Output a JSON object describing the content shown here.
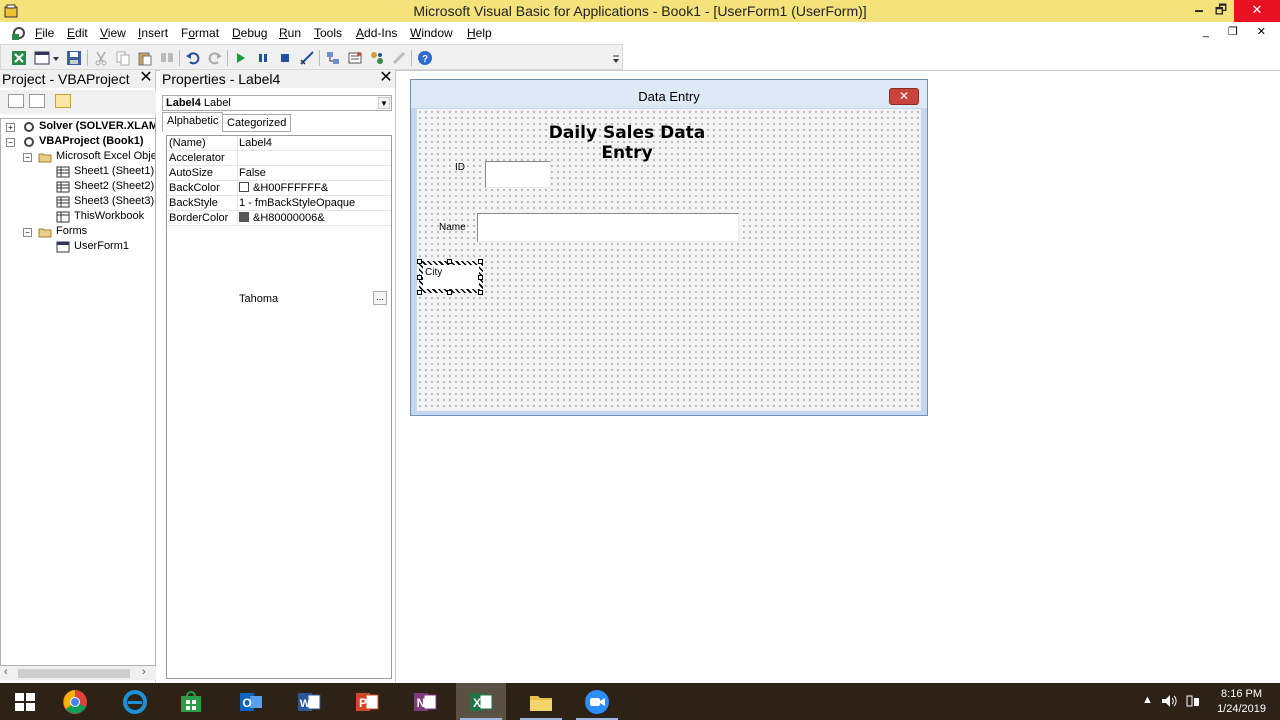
{
  "window": {
    "title": "Microsoft Visual Basic for Applications - Book1 - [UserForm1 (UserForm)]",
    "minimize": "🗕",
    "restore": "🗗",
    "close": "✕"
  },
  "menubar": {
    "items": [
      {
        "pre": "",
        "u": "F",
        "post": "ile"
      },
      {
        "pre": "",
        "u": "E",
        "post": "dit"
      },
      {
        "pre": "",
        "u": "V",
        "post": "iew"
      },
      {
        "pre": "",
        "u": "I",
        "post": "nsert"
      },
      {
        "pre": "F",
        "u": "o",
        "post": "rmat"
      },
      {
        "pre": "",
        "u": "D",
        "post": "ebug"
      },
      {
        "pre": "",
        "u": "R",
        "post": "un"
      },
      {
        "pre": "",
        "u": "T",
        "post": "ools"
      },
      {
        "pre": "",
        "u": "A",
        "post": "dd-Ins"
      },
      {
        "pre": "",
        "u": "W",
        "post": "indow"
      },
      {
        "pre": "",
        "u": "H",
        "post": "elp"
      }
    ],
    "mdi_controls": "_ ❐ ✕"
  },
  "project": {
    "title": "Project - VBAProject",
    "close": "✕",
    "tree": [
      {
        "text": "Solver (SOLVER.XLAM)",
        "bold": true
      },
      {
        "text": "VBAProject (Book1)",
        "bold": true
      },
      {
        "text": "Microsoft Excel Objects",
        "bold": false
      },
      {
        "text": "Sheet1 (Sheet1)",
        "bold": false
      },
      {
        "text": "Sheet2 (Sheet2)",
        "bold": false
      },
      {
        "text": "Sheet3 (Sheet3)",
        "bold": false
      },
      {
        "text": "ThisWorkbook",
        "bold": false
      },
      {
        "text": "Forms",
        "bold": false
      },
      {
        "text": "UserForm1",
        "bold": false
      }
    ],
    "expanders": [
      "+",
      "−",
      "−",
      "−"
    ]
  },
  "properties": {
    "title": "Properties - Label4",
    "close": "✕",
    "object_name": "Label4",
    "object_type": "Label",
    "tabs": [
      "Alphabetic",
      "Categorized"
    ],
    "rows": [
      {
        "key": "(Name)",
        "value": "Label4"
      },
      {
        "key": "Accelerator",
        "value": ""
      },
      {
        "key": "AutoSize",
        "value": "False"
      },
      {
        "key": "BackColor",
        "value": "&H00FFFFFF&",
        "swatch": "#ffffff"
      },
      {
        "key": "BackStyle",
        "value": "1 - fmBackStyleOpaque"
      },
      {
        "key": "BorderColor",
        "value": "&H80000006&",
        "swatch": "#555555"
      }
    ],
    "font_value": "Tahoma",
    "ellipsis": "..."
  },
  "form": {
    "title": "Data Entry",
    "close": "✕",
    "heading": "Daily Sales Data Entry",
    "label_id": "ID",
    "label_name": "Name",
    "label_city": "City"
  },
  "taskbar": {
    "time": "8:16 PM",
    "date": "1/24/2019",
    "apps": [
      {
        "name": "start",
        "color": "#ffffff"
      },
      {
        "name": "chrome",
        "color": "#db4437"
      },
      {
        "name": "edge",
        "color": "#1e90d8"
      },
      {
        "name": "store",
        "color": "#2aa046"
      },
      {
        "name": "outlook",
        "color": "#0a64c0"
      },
      {
        "name": "word",
        "color": "#2b579a"
      },
      {
        "name": "powerpoint",
        "color": "#d24726"
      },
      {
        "name": "onenote",
        "color": "#80397b"
      },
      {
        "name": "excel",
        "color": "#217346"
      },
      {
        "name": "file-explorer",
        "color": "#e8c04a"
      },
      {
        "name": "zoom",
        "color": "#2d8cff"
      }
    ],
    "tray_chevron": "▲"
  }
}
